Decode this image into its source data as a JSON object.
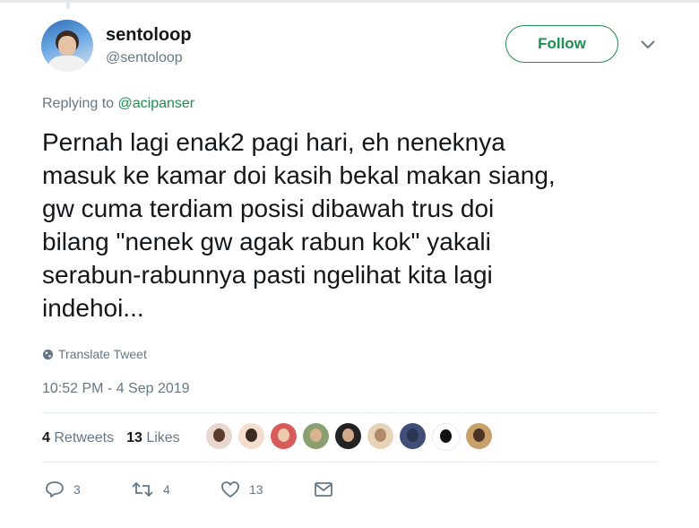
{
  "author": {
    "display_name": "sentoloop",
    "handle": "@sentoloop"
  },
  "follow_label": "Follow",
  "reply": {
    "prefix": "Replying to",
    "mention": "@acipanser"
  },
  "tweet_text": "Pernah lagi enak2 pagi hari, eh neneknya\nmasuk ke kamar doi kasih bekal makan siang,\ngw cuma terdiam posisi dibawah trus doi\nbilang \"nenek gw agak rabun kok\" yakali\nserabun-rabunnya pasti ngelihat kita lagi\nindehoi...",
  "translate_label": "Translate Tweet",
  "timestamp": "10:52 PM - 4 Sep 2019",
  "stats": {
    "retweets_count": "4",
    "retweets_label": "Retweets",
    "likes_count": "13",
    "likes_label": "Likes"
  },
  "liker_avatars": [
    {
      "bg": "#e9d7cf",
      "face": "#5a3b2e"
    },
    {
      "bg": "#f4ded0",
      "face": "#3b2a22"
    },
    {
      "bg": "#d85b5b",
      "face": "#f1c9ad"
    },
    {
      "bg": "#8aa070",
      "face": "#d9b38c"
    },
    {
      "bg": "#222222",
      "face": "#d1a98a"
    },
    {
      "bg": "#e7d3b8",
      "face": "#b08a6a"
    },
    {
      "bg": "#3f4f7a",
      "face": "#2b3552"
    },
    {
      "bg": "#ffffff",
      "face": "#111111"
    },
    {
      "bg": "#caa06a",
      "face": "#4a3424"
    }
  ],
  "actions": {
    "reply_count": "3",
    "retweet_count": "4",
    "like_count": "13"
  },
  "colors": {
    "accent": "#1b8f4e",
    "secondary_text": "#657786"
  }
}
